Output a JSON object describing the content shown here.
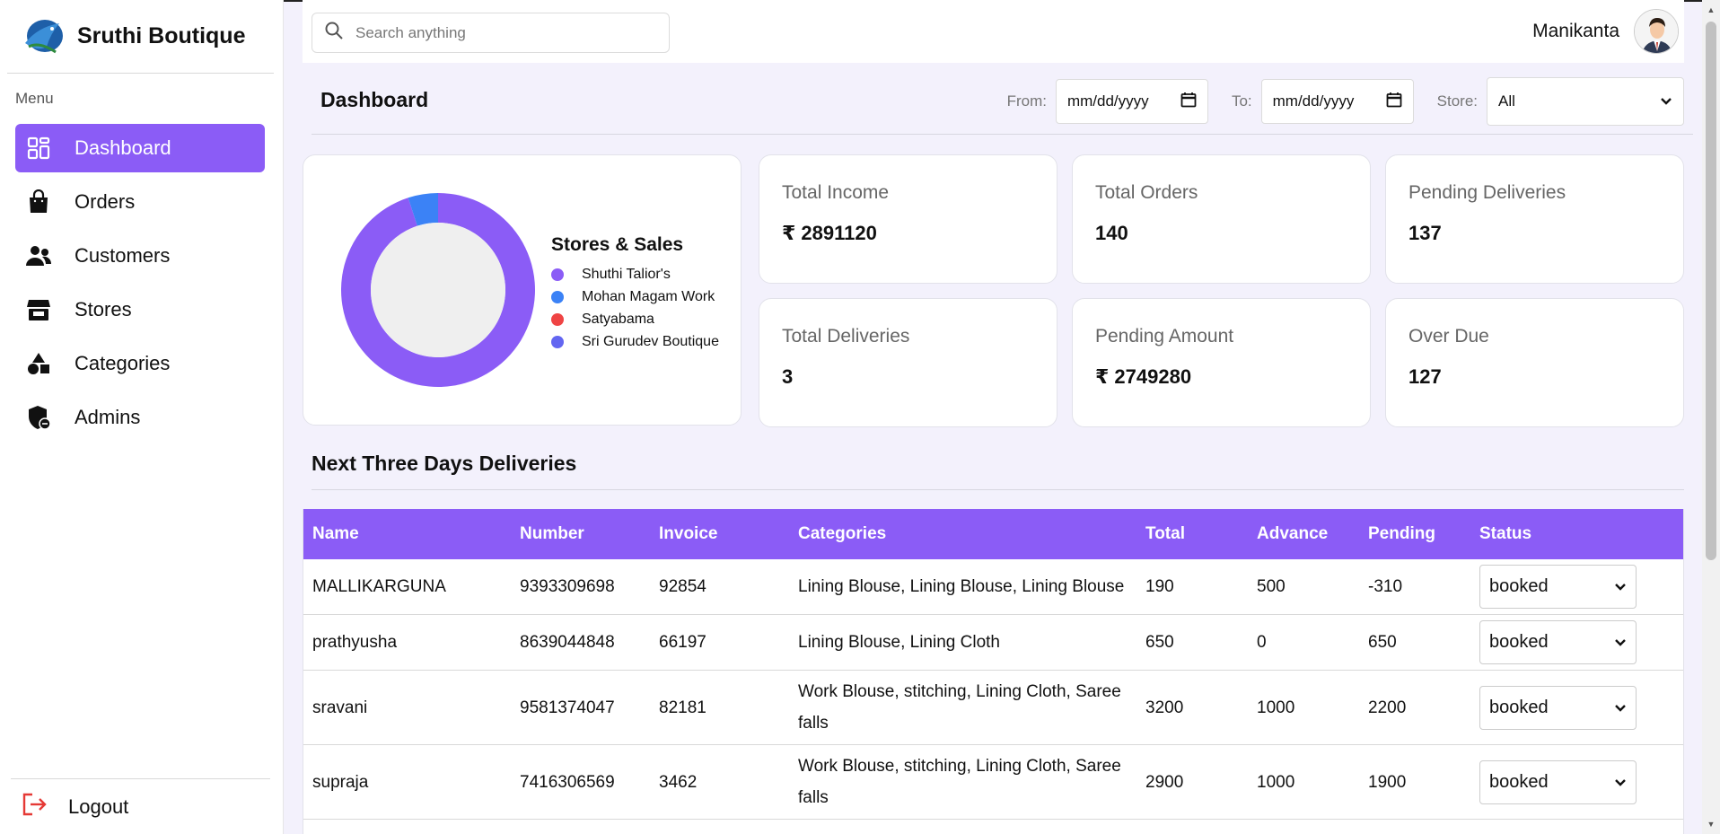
{
  "brand": {
    "name": "Sruthi Boutique",
    "logo": "bird-logo-icon"
  },
  "sidebar": {
    "menu_label": "Menu",
    "items": [
      {
        "label": "Dashboard",
        "icon": "grid-icon",
        "active": true
      },
      {
        "label": "Orders",
        "icon": "shopping-bag-icon",
        "active": false
      },
      {
        "label": "Customers",
        "icon": "users-icon",
        "active": false
      },
      {
        "label": "Stores",
        "icon": "store-icon",
        "active": false
      },
      {
        "label": "Categories",
        "icon": "shapes-icon",
        "active": false
      },
      {
        "label": "Admins",
        "icon": "shield-icon",
        "active": false
      }
    ],
    "logout_label": "Logout"
  },
  "topbar": {
    "search_placeholder": "Search anything",
    "user_name": "Manikanta"
  },
  "header": {
    "title": "Dashboard",
    "from_label": "From:",
    "from_value": "mm/dd/yyyy",
    "to_label": "To:",
    "to_value": "mm/dd/yyyy",
    "store_label": "Store:",
    "store_value": "All"
  },
  "chart_data": {
    "type": "pie",
    "title": "Stores & Sales",
    "donut": true,
    "series": [
      {
        "name": "Shuthi Talior's",
        "value": 0.95,
        "color": "#8b5cf6"
      },
      {
        "name": "Mohan Magam Work",
        "value": 0.05,
        "color": "#3b82f6"
      },
      {
        "name": "Satyabama",
        "value": 0,
        "color": "#ef4444"
      },
      {
        "name": "Sri Gurudev Boutique",
        "value": 0,
        "color": "#6366f1"
      }
    ]
  },
  "stats": [
    {
      "label": "Total Income",
      "value": "₹ 2891120"
    },
    {
      "label": "Total Orders",
      "value": "140"
    },
    {
      "label": "Pending Deliveries",
      "value": "137"
    },
    {
      "label": "Total Deliveries",
      "value": "3"
    },
    {
      "label": "Pending Amount",
      "value": "₹ 2749280"
    },
    {
      "label": "Over Due",
      "value": "127"
    }
  ],
  "deliveries": {
    "title": "Next Three Days Deliveries",
    "columns": [
      "Name",
      "Number",
      "Invoice",
      "Categories",
      "Total",
      "Advance",
      "Pending",
      "Status"
    ],
    "rows": [
      {
        "name": "MALLIKARGUNA",
        "number": "9393309698",
        "invoice": "92854",
        "categories": "Lining Blouse, Lining Blouse, Lining Blouse",
        "total": "190",
        "advance": "500",
        "pending": "-310",
        "status": "booked"
      },
      {
        "name": "prathyusha",
        "number": "8639044848",
        "invoice": "66197",
        "categories": "Lining Blouse, Lining Cloth",
        "total": "650",
        "advance": "0",
        "pending": "650",
        "status": "booked"
      },
      {
        "name": "sravani",
        "number": "9581374047",
        "invoice": "82181",
        "categories": "Work Blouse, stitching, Lining Cloth, Saree falls",
        "total": "3200",
        "advance": "1000",
        "pending": "2200",
        "status": "booked"
      },
      {
        "name": "supraja",
        "number": "7416306569",
        "invoice": "3462",
        "categories": "Work Blouse, stitching, Lining Cloth, Saree falls",
        "total": "2900",
        "advance": "1000",
        "pending": "1900",
        "status": "booked"
      }
    ]
  }
}
